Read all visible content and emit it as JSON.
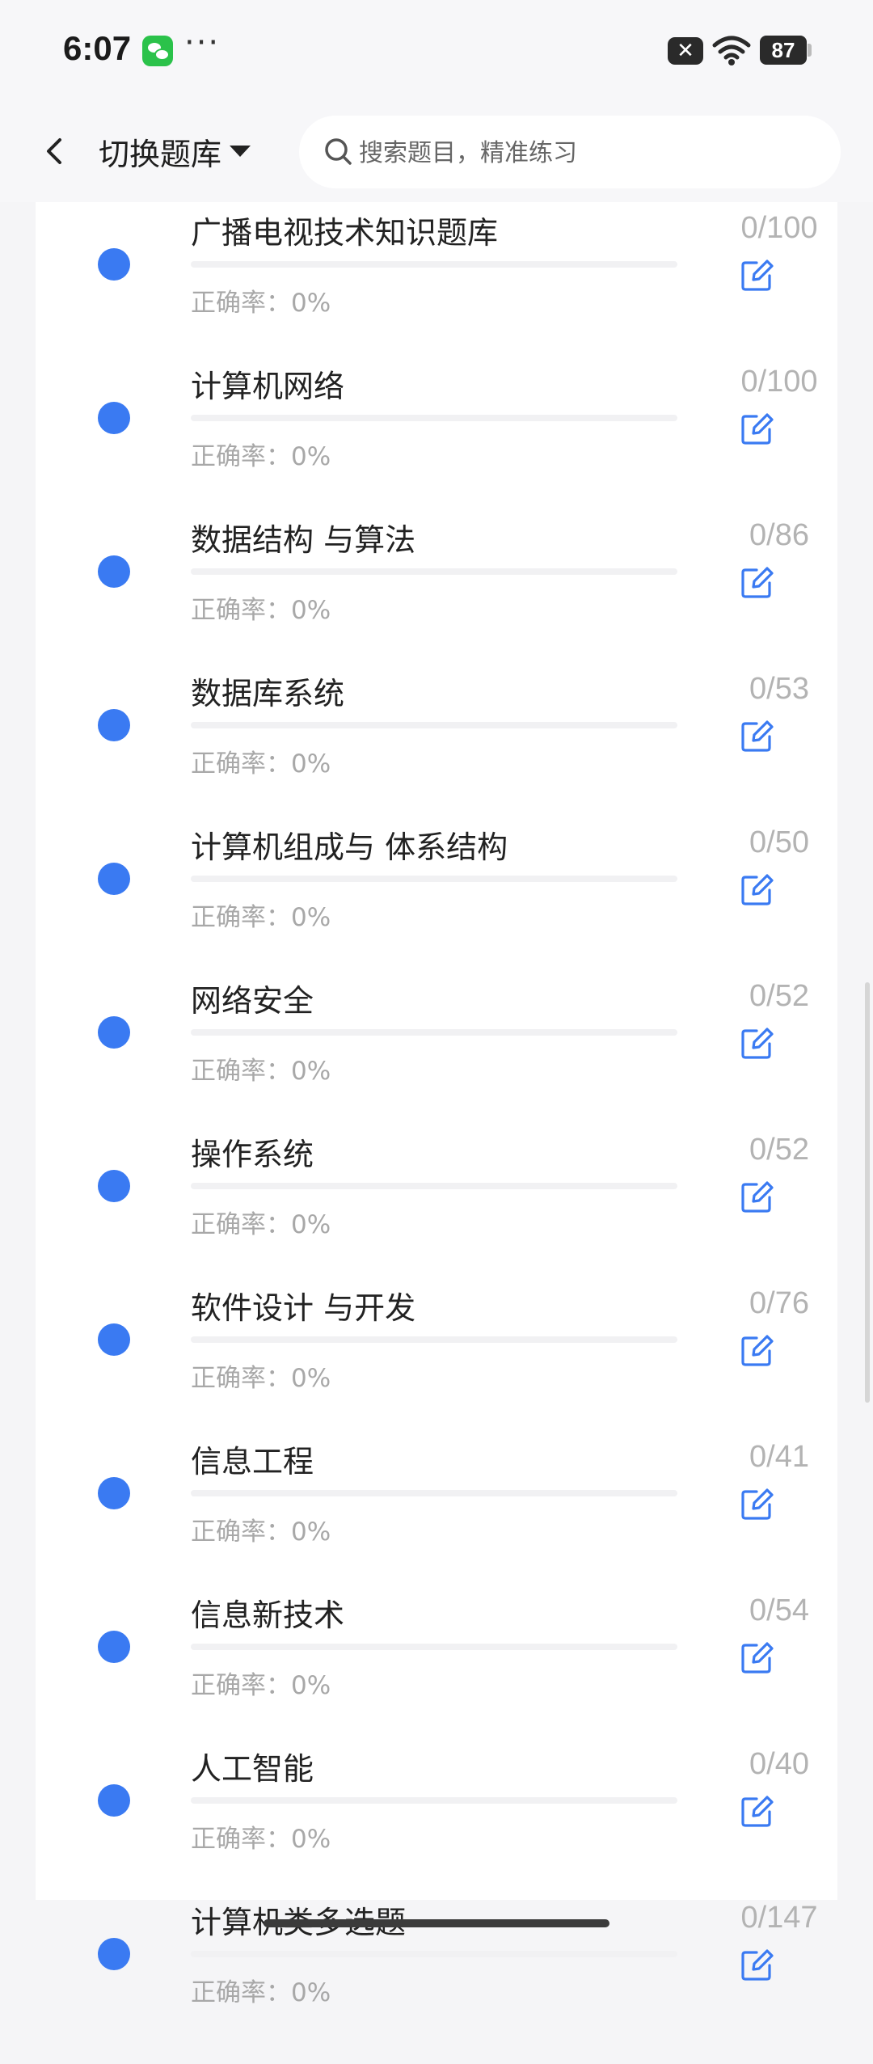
{
  "status_bar": {
    "time": "6:07",
    "notification_icon": "wechat-icon",
    "more": "···",
    "battery": "87"
  },
  "header": {
    "back_icon": "chevron-left-icon",
    "bank_switch_label": "切换题库",
    "search_placeholder": "搜索题目，精准练习"
  },
  "list": {
    "accuracy_label": "正确率：0%",
    "accent_color": "#3a7af2",
    "items": [
      {
        "title": "广播电视技术知识题库",
        "count": "0/100",
        "progress": 0
      },
      {
        "title": "计算机网络",
        "count": "0/100",
        "progress": 0
      },
      {
        "title": "数据结构 与算法",
        "count": "0/86",
        "progress": 0
      },
      {
        "title": "数据库系统",
        "count": "0/53",
        "progress": 0
      },
      {
        "title": "计算机组成与 体系结构",
        "count": "0/50",
        "progress": 0
      },
      {
        "title": "网络安全",
        "count": "0/52",
        "progress": 0
      },
      {
        "title": "操作系统",
        "count": "0/52",
        "progress": 0
      },
      {
        "title": "软件设计 与开发",
        "count": "0/76",
        "progress": 0
      },
      {
        "title": "信息工程",
        "count": "0/41",
        "progress": 0
      },
      {
        "title": "信息新技术",
        "count": "0/54",
        "progress": 0
      },
      {
        "title": "人工智能",
        "count": "0/40",
        "progress": 0
      },
      {
        "title": "计算机类多选题",
        "count": "0/147",
        "progress": 0
      }
    ]
  }
}
